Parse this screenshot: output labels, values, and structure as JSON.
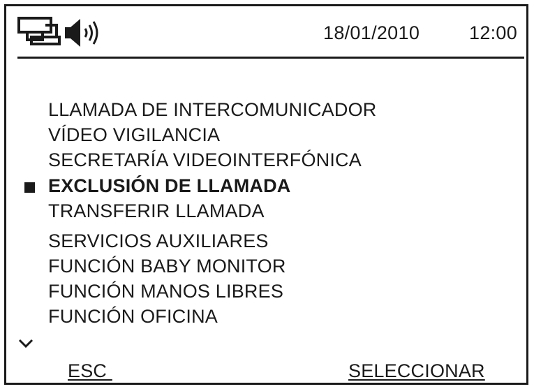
{
  "status_bar": {
    "icons": [
      "intercom-icon",
      "speaker-icon"
    ],
    "date": "18/01/2010",
    "time": "12:00"
  },
  "menu": {
    "items": [
      {
        "label": "LLAMADA DE INTERCOMUNICADOR",
        "selected": false
      },
      {
        "label": "VÍDEO VIGILANCIA",
        "selected": false
      },
      {
        "label": "SECRETARÍA VIDEOINTERFÓNICA",
        "selected": false
      },
      {
        "label": "EXCLUSIÓN DE LLAMADA",
        "selected": true
      },
      {
        "label": "TRANSFERIR LLAMADA",
        "selected": false
      },
      {
        "label": "SERVICIOS AUXILIARES",
        "selected": false
      },
      {
        "label": "FUNCIÓN BABY MONITOR",
        "selected": false
      },
      {
        "label": "FUNCIÓN MANOS LIBRES",
        "selected": false
      },
      {
        "label": "FUNCIÓN OFICINA",
        "selected": false
      }
    ],
    "more_indicator": "chevron-down-icon"
  },
  "softkeys": {
    "left": "ESC ",
    "right": "SELECCIONAR"
  }
}
